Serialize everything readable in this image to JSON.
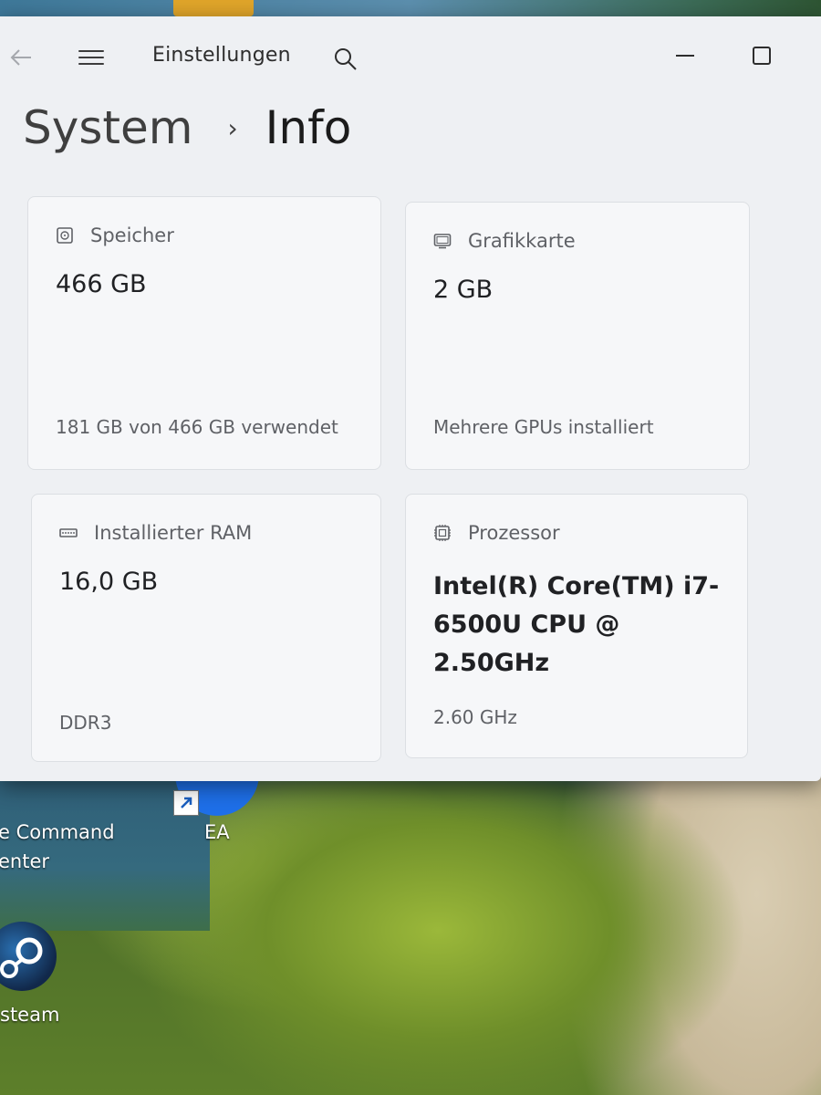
{
  "window": {
    "app_title": "Einstellungen",
    "back_icon": "arrow-left-icon",
    "menu_icon": "hamburger-menu-icon",
    "search_icon": "search-icon",
    "minimize_icon": "minimize-icon",
    "maximize_icon": "maximize-icon"
  },
  "breadcrumb": {
    "parent": "System",
    "separator": "›",
    "current": "Info"
  },
  "cards": {
    "storage": {
      "icon": "hard-drive-icon",
      "label": "Speicher",
      "value": "466 GB",
      "sub": "181 GB von 466 GB verwendet"
    },
    "gpu": {
      "icon": "monitor-icon",
      "label": "Grafikkarte",
      "value": "2 GB",
      "sub": "Mehrere GPUs installiert"
    },
    "ram": {
      "icon": "memory-module-icon",
      "label": "Installierter RAM",
      "value": "16,0 GB",
      "sub": "DDR3"
    },
    "cpu": {
      "icon": "processor-chip-icon",
      "label": "Prozessor",
      "value": "Intel(R) Core(TM) i7-6500U CPU @ 2.50GHz",
      "sub": "2.60 GHz"
    }
  },
  "desktop": {
    "shortcut_command_line1": "e Command",
    "shortcut_command_line2": "enter",
    "shortcut_ea": "EA",
    "shortcut_steam": "steam"
  },
  "colors": {
    "window_bg": "#eef0f3",
    "card_bg": "#f6f7f9",
    "card_border": "#dcdfe3",
    "text_primary": "#202124",
    "text_secondary": "#5f6166"
  }
}
